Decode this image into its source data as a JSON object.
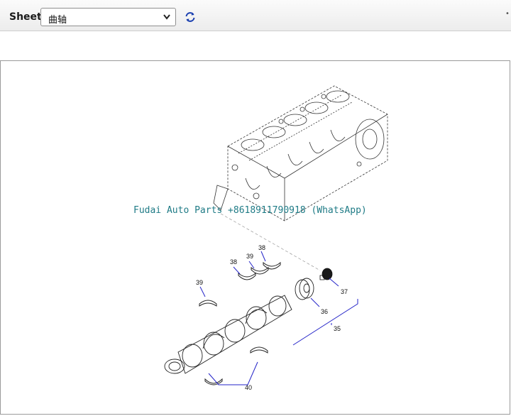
{
  "toolbar": {
    "sheet_label": "Sheet",
    "selected_sheet": "曲轴",
    "refresh_icon": "refresh-icon",
    "dropdown_icon": "chevron-down-icon"
  },
  "diagram": {
    "watermark": "Fudai Auto Parts +8618911790918 (WhatsApp)",
    "callouts": {
      "c38a": "38",
      "c39a": "39",
      "c38b": "38",
      "c39b": "39",
      "c37": "37",
      "c36": "36",
      "c35": "35",
      "c40": "40"
    },
    "accent_color": "#2323c8"
  }
}
